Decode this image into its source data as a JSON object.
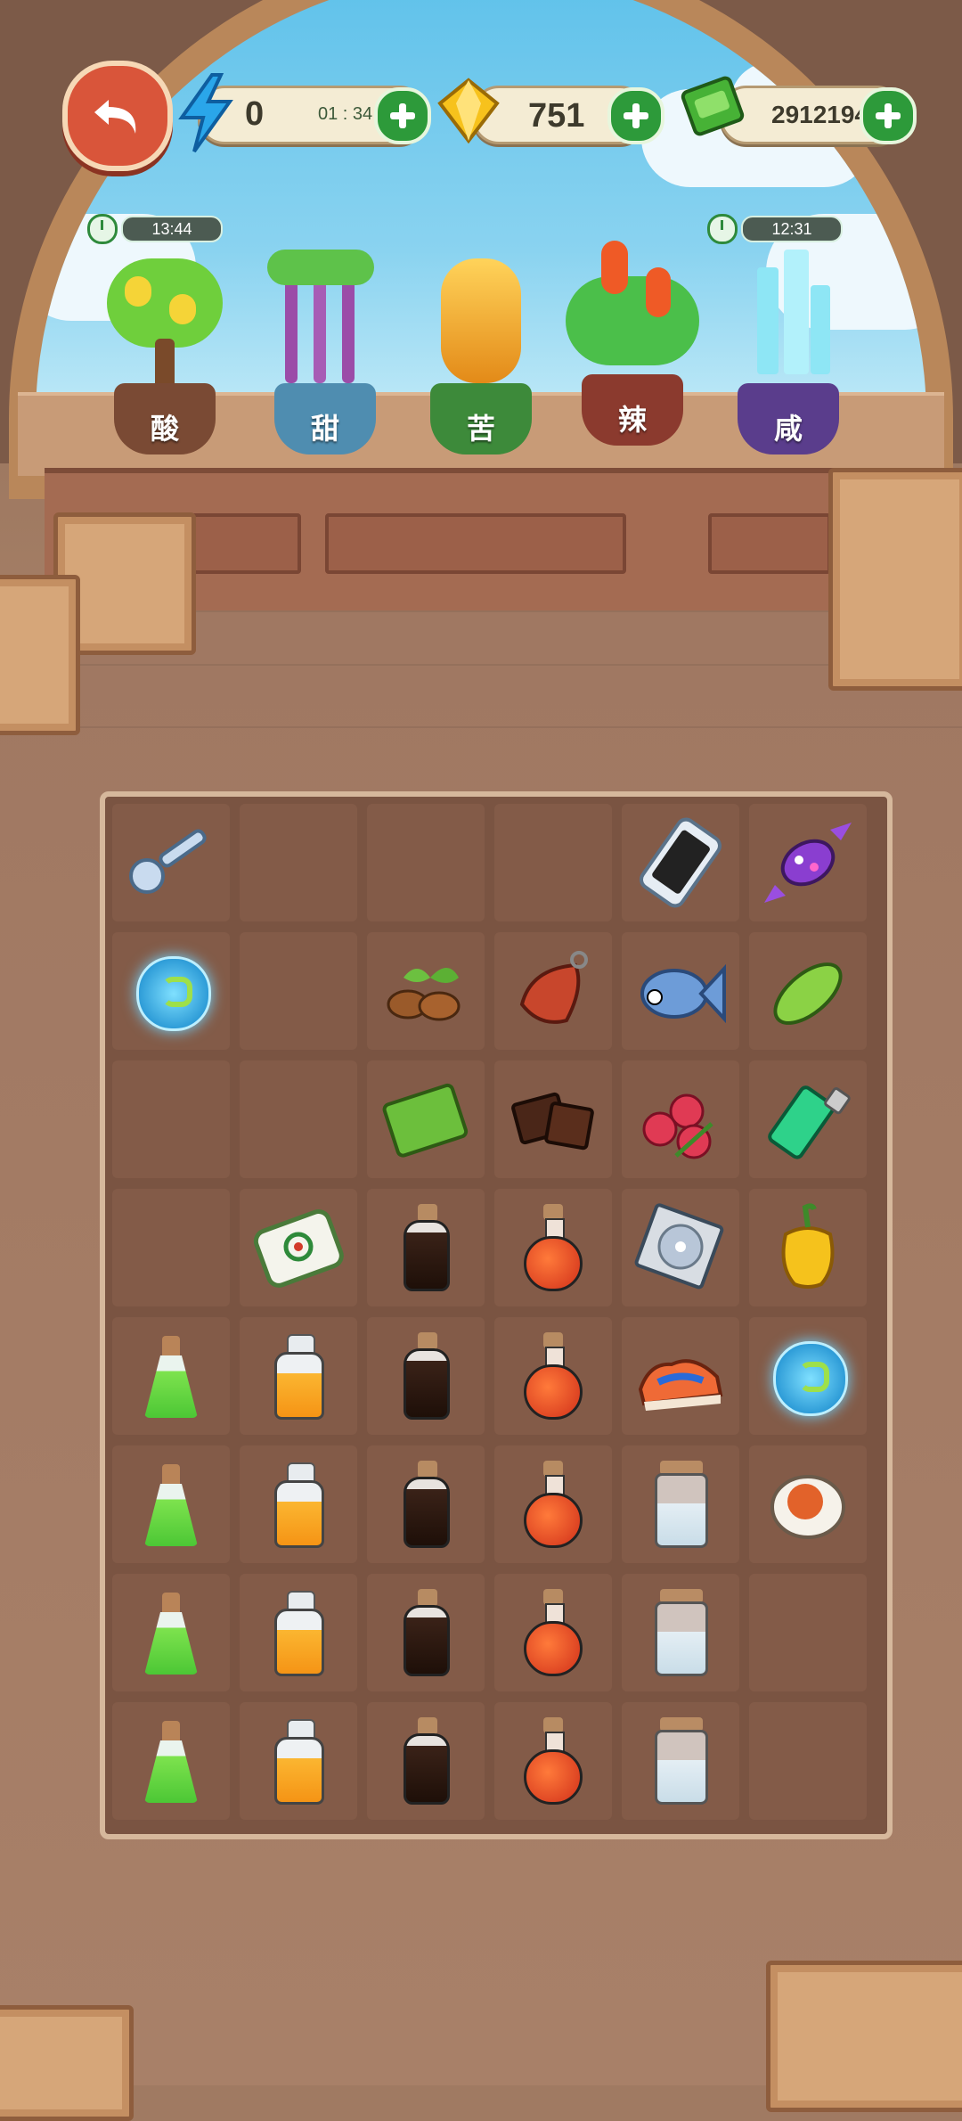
{
  "hud": {
    "energy": {
      "value": "0",
      "timer": "01 : 34"
    },
    "gems": {
      "value": "751"
    },
    "cash": {
      "value": "2912194"
    }
  },
  "plants": [
    {
      "label": "酸",
      "timer": "13:44",
      "pot_color": "#7a4a34"
    },
    {
      "label": "甜",
      "timer": "",
      "pot_color": "#4f8db0"
    },
    {
      "label": "苦",
      "timer": "",
      "pot_color": "#3d8a3a"
    },
    {
      "label": "辣",
      "timer": "",
      "pot_color": "#8b3a2e"
    },
    {
      "label": "咸",
      "timer": "12:31",
      "pot_color": "#5a3d8c"
    }
  ],
  "board": {
    "columns": 6,
    "rows": 8,
    "cells": [
      [
        "key",
        "",
        "",
        "",
        "smartphone",
        "candy"
      ],
      [
        "seed-bubble",
        "",
        "coffee-beans",
        "ham",
        "fish",
        "bitter-melon"
      ],
      [
        "",
        "",
        "notebook",
        "chocolate",
        "lychee",
        "lighter"
      ],
      [
        "",
        "mahjong-tile",
        "soy-sauce-bottle",
        "chili-oil-flask",
        "cd-disc",
        "yellow-pepper"
      ],
      [
        "green-flask",
        "honey-jar",
        "soy-sauce-bottle",
        "chili-oil-flask",
        "sneaker",
        "seed-bubble"
      ],
      [
        "green-flask",
        "honey-jar",
        "soy-sauce-bottle",
        "chili-oil-flask",
        "salt-jar",
        "salted-egg"
      ],
      [
        "green-flask",
        "honey-jar",
        "soy-sauce-bottle",
        "chili-oil-flask",
        "salt-jar",
        ""
      ],
      [
        "green-flask",
        "honey-jar",
        "soy-sauce-bottle",
        "chili-oil-flask",
        "salt-jar",
        ""
      ]
    ]
  }
}
